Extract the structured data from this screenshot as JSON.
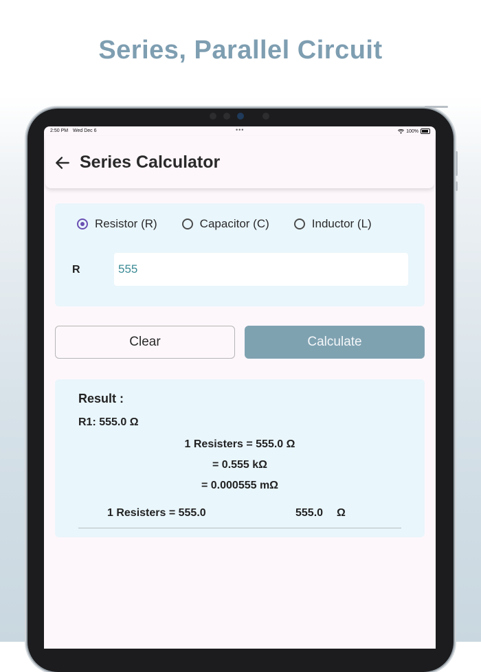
{
  "headline": "Series, Parallel Circuit",
  "status_bar": {
    "time": "2:50 PM",
    "date": "Wed Dec 6",
    "dots": "•••",
    "battery": "100%"
  },
  "app_bar": {
    "title": "Series Calculator",
    "back_icon": "arrow-left-icon"
  },
  "component_selector": {
    "options": [
      {
        "label": "Resistor (R)",
        "selected": true
      },
      {
        "label": "Capacitor (C)",
        "selected": false
      },
      {
        "label": "Inductor (L)",
        "selected": false
      }
    ],
    "accent_color": "#6a4fb3"
  },
  "input": {
    "label": "R",
    "value": "555"
  },
  "buttons": {
    "clear": "Clear",
    "calculate": "Calculate",
    "calculate_color": "#7fa2b1"
  },
  "result": {
    "title": "Result :",
    "r1": "R1: 555.0 Ω",
    "lines": [
      "1 Resisters = 555.0 Ω",
      "= 0.555 kΩ",
      "= 0.000555 mΩ"
    ],
    "summary_left": "1 Resisters = 555.0",
    "summary_value": "555.0",
    "summary_unit": "Ω"
  }
}
